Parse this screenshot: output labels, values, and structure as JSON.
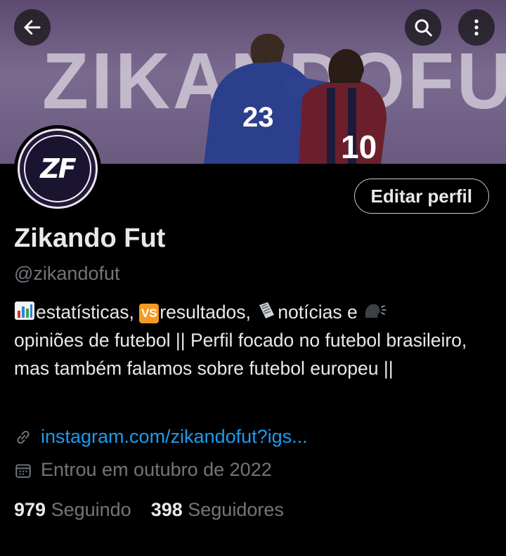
{
  "header": {
    "banner_text": "ZIKANDOFUT",
    "back_icon": "arrow-left-icon",
    "search_icon": "search-icon",
    "more_icon": "more-vertical-icon"
  },
  "profile": {
    "avatar_text": "ZF",
    "edit_button": "Editar perfil",
    "display_name": "Zikando Fut",
    "handle": "@zikandofut",
    "bio": {
      "part1": "estatísticas, ",
      "part2": "resultados, ",
      "part3": "notícias e ",
      "part4": "opiniões de futebol  || Perfil focado no futebol brasileiro, mas também falamos sobre futebol europeu ||"
    },
    "link": "instagram.com/zikandofut?igs...",
    "joined": "Entrou em outubro de 2022",
    "following_count": "979",
    "following_label": "Seguindo",
    "followers_count": "398",
    "followers_label": "Seguidores"
  },
  "colors": {
    "accent": "#1d9bf0",
    "muted": "#71767b",
    "background": "#000000"
  }
}
